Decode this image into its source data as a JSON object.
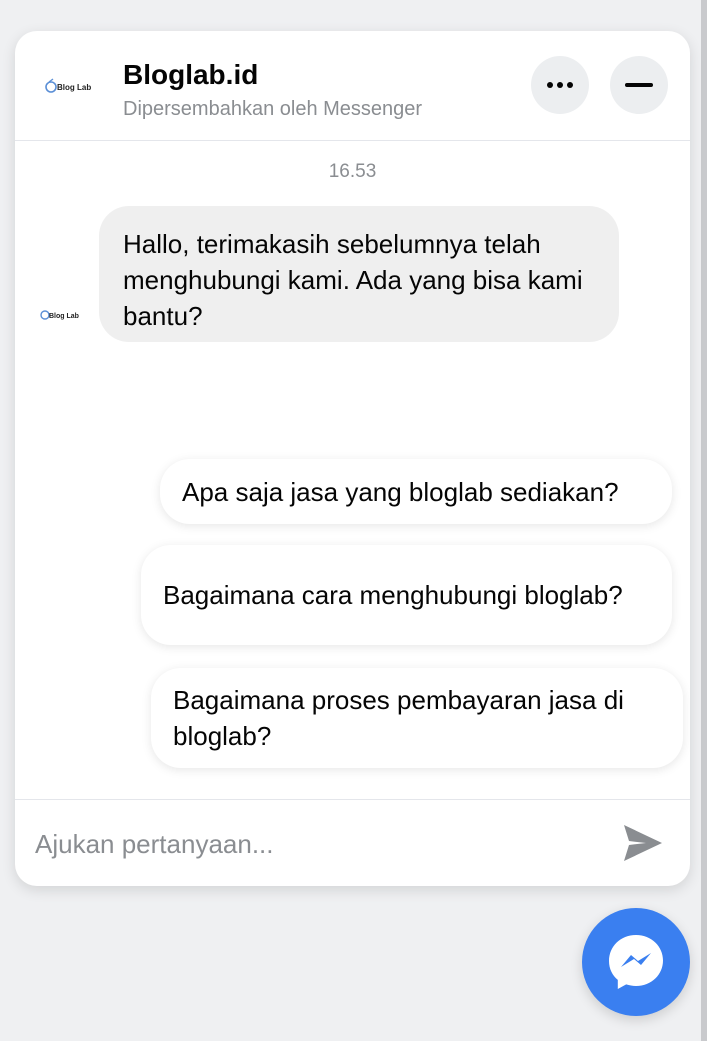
{
  "header": {
    "title": "Bloglab.id",
    "subtitle": "Dipersembahkan oleh Messenger",
    "logo_text": "Blog Lab",
    "more_icon": "more-dots-icon",
    "minimize_icon": "minimize-icon"
  },
  "conversation": {
    "timestamp": "16.53",
    "incoming_message": "Hallo, terimakasih sebelumnya telah menghubungi kami. Ada yang bisa kami bantu?",
    "avatar_text": "Blog Lab"
  },
  "quick_replies": [
    {
      "label": "Apa saja jasa yang bloglab sediakan?"
    },
    {
      "label": "Bagaimana cara menghubungi bloglab?"
    },
    {
      "label": "Bagaimana proses pembayaran jasa di bloglab?"
    }
  ],
  "composer": {
    "placeholder": "Ajukan pertanyaan...",
    "value": "",
    "send_icon": "send-icon"
  },
  "launcher": {
    "icon": "messenger-icon"
  },
  "colors": {
    "brand": "#3a7ff0",
    "incoming_bubble": "#efefef",
    "muted_text": "#8a8d91",
    "send_icon": "#8a8d91"
  }
}
